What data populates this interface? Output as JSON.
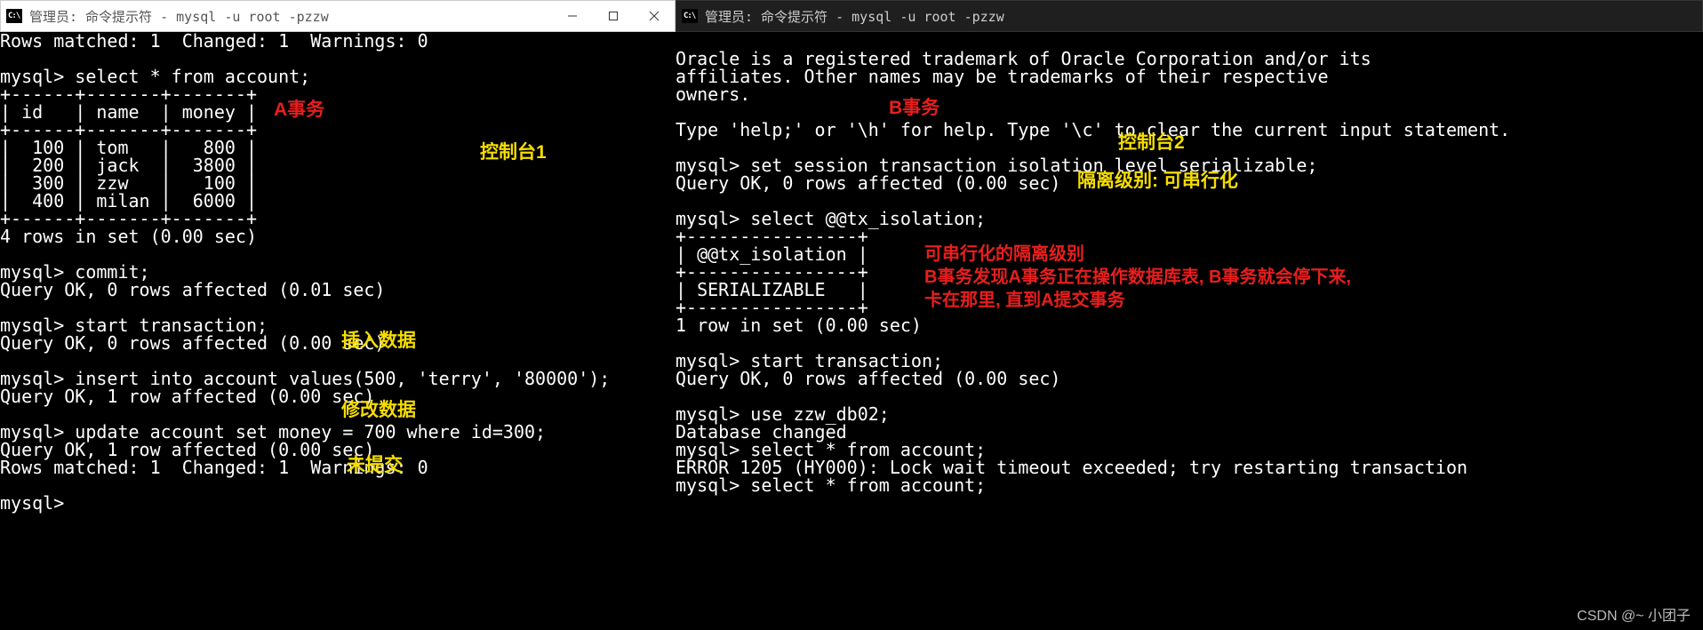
{
  "window1": {
    "title": "管理员: 命令提示符 - mysql  -u root -pzzw",
    "controls": {
      "min": "—",
      "max": "□",
      "close": "×"
    },
    "term": "Rows matched: 1  Changed: 1  Warnings: 0\n\nmysql> select * from account;\n+------+-------+-------+\n| id   | name  | money |\n+------+-------+-------+\n|  100 | tom   |   800 |\n|  200 | jack  |  3800 |\n|  300 | zzw   |   100 |\n|  400 | milan |  6000 |\n+------+-------+-------+\n4 rows in set (0.00 sec)\n\nmysql> commit;\nQuery OK, 0 rows affected (0.01 sec)\n\nmysql> start transaction;\nQuery OK, 0 rows affected (0.00 sec)\n\nmysql> insert into account values(500, 'terry', '80000');\nQuery OK, 1 row affected (0.00 sec)\n\nmysql> update account set money = 700 where id=300;\nQuery OK, 1 row affected (0.00 sec)\nRows matched: 1  Changed: 1  Warnings: 0\n\nmysql>",
    "annots": {
      "a_txn": "A事务",
      "console1": "控制台1",
      "insert": "插入数据",
      "modify": "修改数据",
      "uncommitted": "未提交"
    }
  },
  "window2": {
    "title": "管理员: 命令提示符 - mysql  -u root -pzzw",
    "term": "\nOracle is a registered trademark of Oracle Corporation and/or its\naffiliates. Other names may be trademarks of their respective\nowners.\n\nType 'help;' or '\\h' for help. Type '\\c' to clear the current input statement.\n\nmysql> set session transaction isolation level serializable;\nQuery OK, 0 rows affected (0.00 sec)\n\nmysql> select @@tx_isolation;\n+----------------+\n| @@tx_isolation |\n+----------------+\n| SERIALIZABLE   |\n+----------------+\n1 row in set (0.00 sec)\n\nmysql> start transaction;\nQuery OK, 0 rows affected (0.00 sec)\n\nmysql> use zzw_db02;\nDatabase changed\nmysql> select * from account;\nERROR 1205 (HY000): Lock wait timeout exceeded; try restarting transaction\nmysql> select * from account;",
    "annots": {
      "b_txn": "B事务",
      "console2": "控制台2",
      "iso_level": "隔离级别: 可串行化",
      "title_line": "可串行化的隔离级别",
      "line2": "B事务发现A事务正在操作数据库表, B事务就会停下来,",
      "line3": "卡在那里, 直到A提交事务"
    }
  },
  "watermark": "CSDN @~ 小团子"
}
